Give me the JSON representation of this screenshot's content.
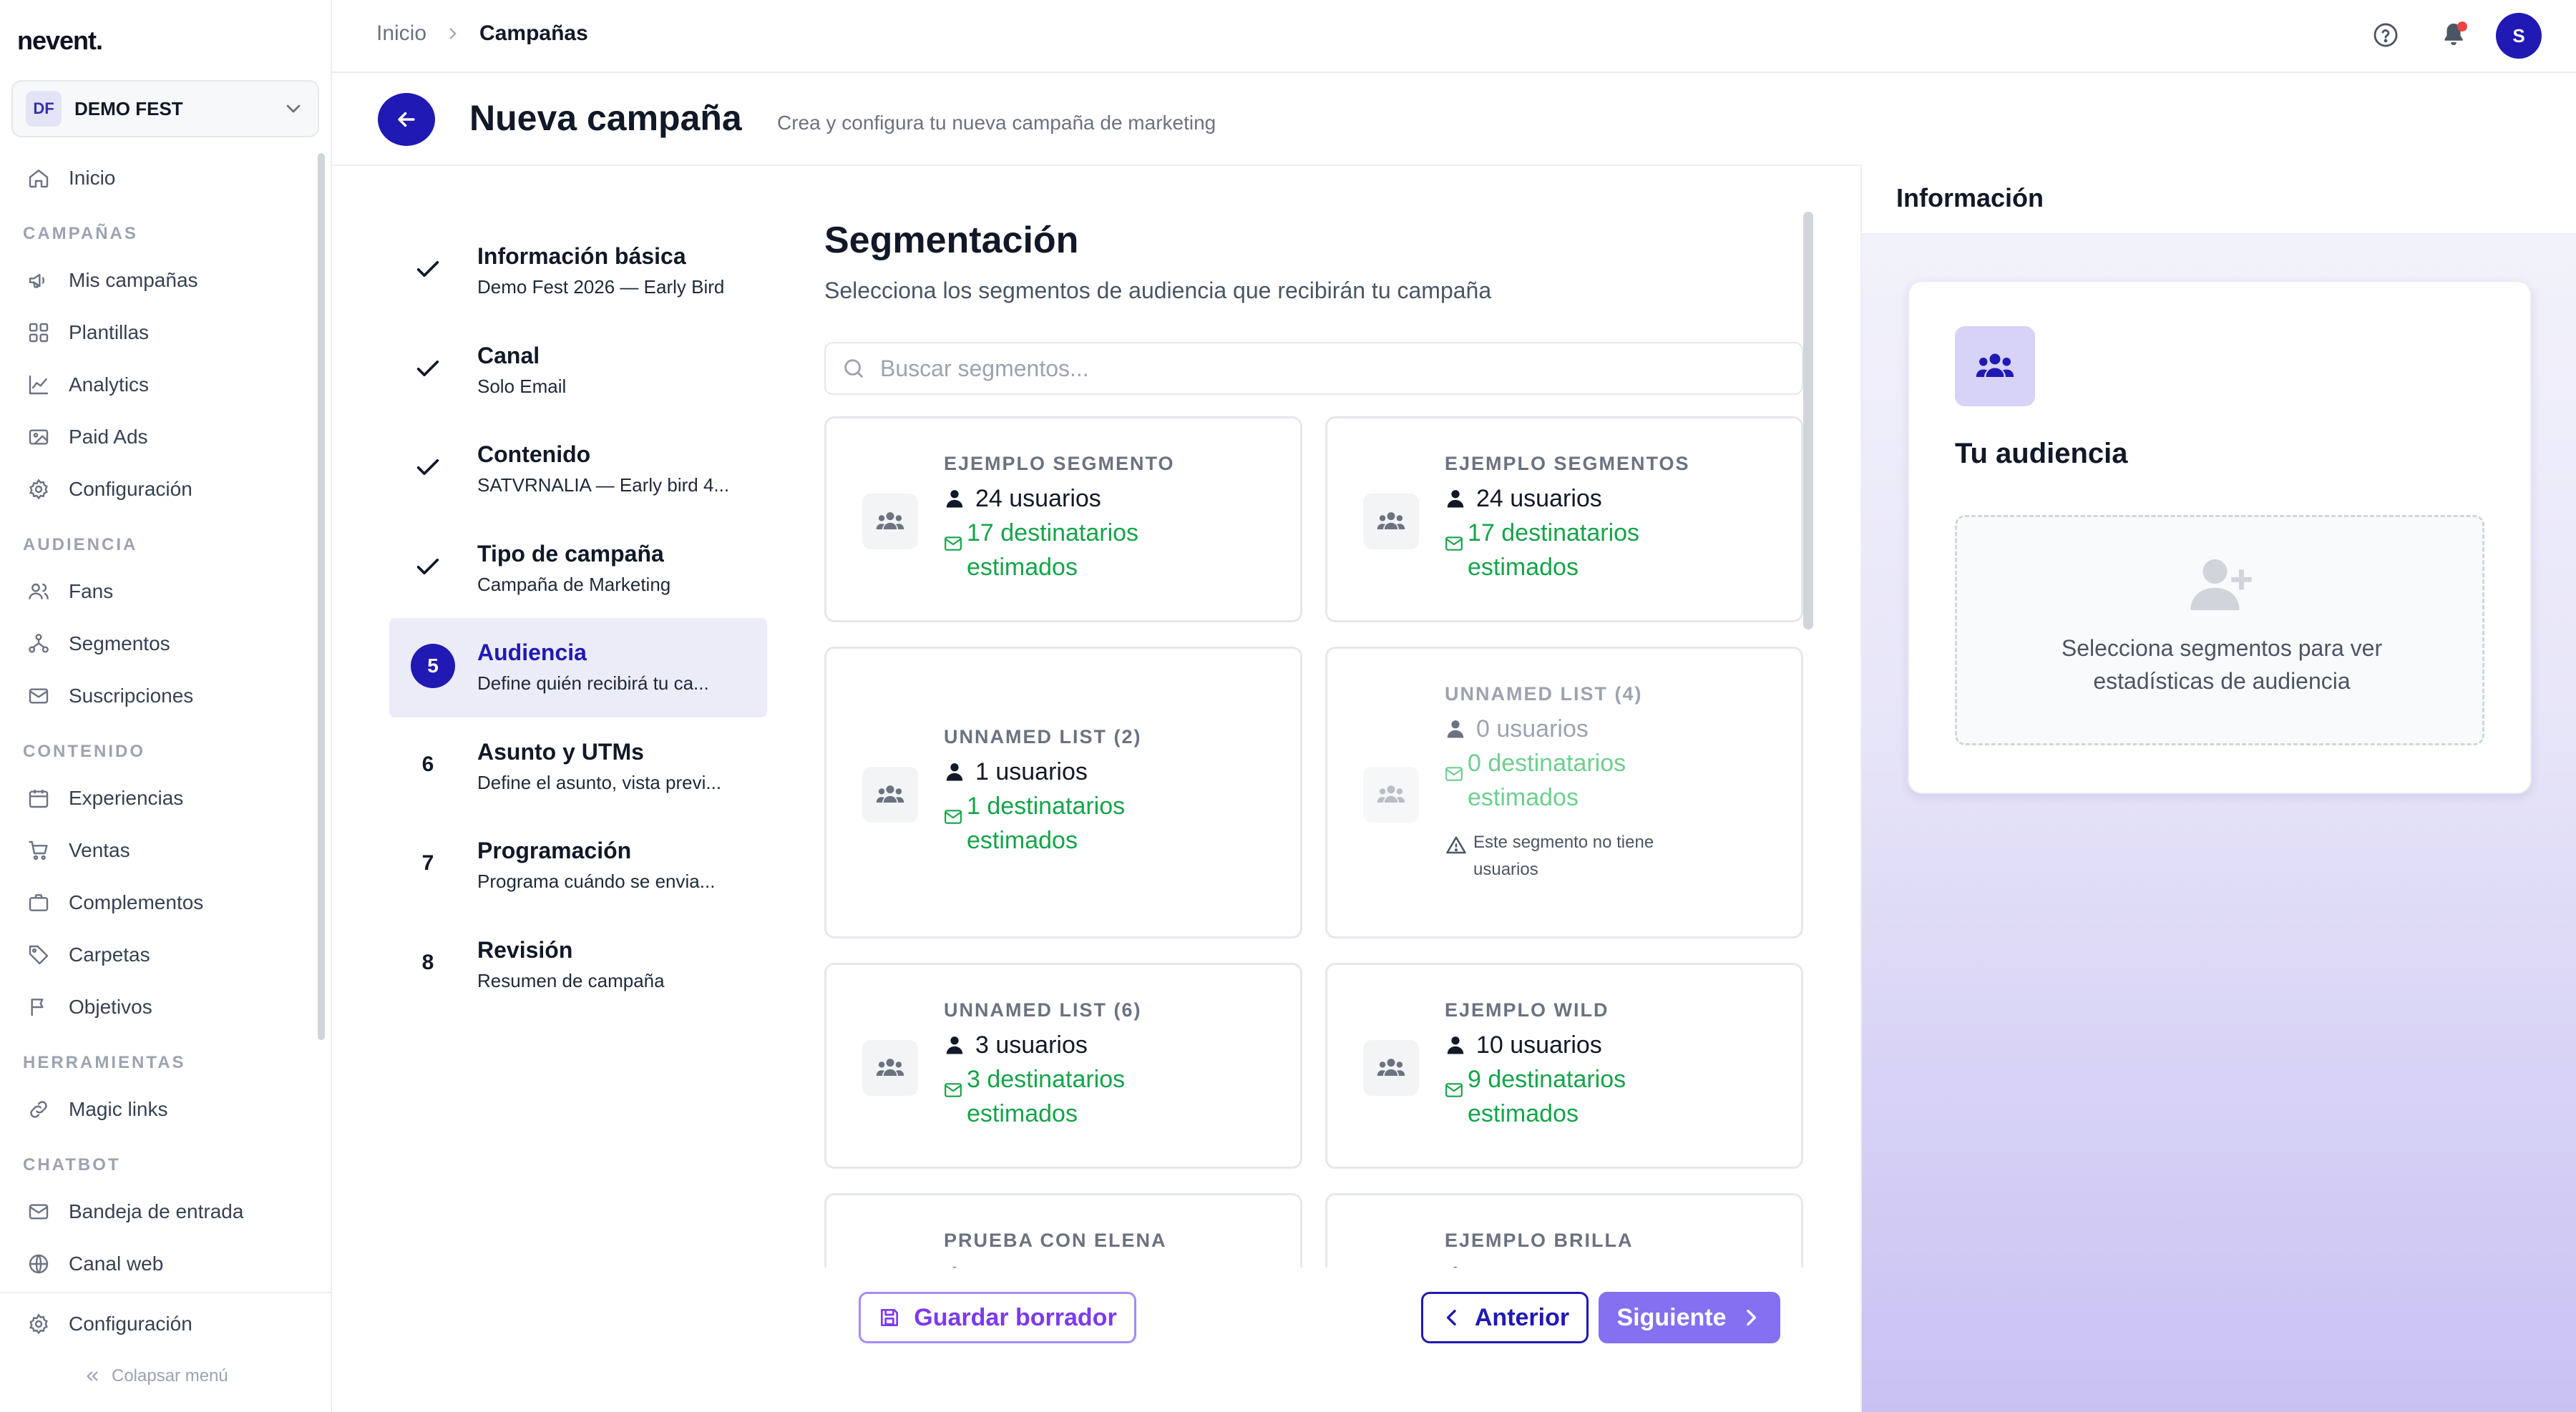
{
  "app": {
    "logo": "nevent."
  },
  "org": {
    "initials": "DF",
    "name": "DEMO FEST"
  },
  "sidebar": {
    "inicio": "Inicio",
    "sec_campanas": "CAMPAÑAS",
    "mis_campanas": "Mis campañas",
    "plantillas": "Plantillas",
    "analytics": "Analytics",
    "paid_ads": "Paid Ads",
    "configuracion": "Configuración",
    "sec_audiencia": "AUDIENCIA",
    "fans": "Fans",
    "segmentos": "Segmentos",
    "suscripciones": "Suscripciones",
    "sec_contenido": "CONTENIDO",
    "experiencias": "Experiencias",
    "ventas": "Ventas",
    "complementos": "Complementos",
    "carpetas": "Carpetas",
    "objetivos": "Objetivos",
    "sec_herramientas": "HERRAMIENTAS",
    "magic_links": "Magic links",
    "sec_chatbot": "CHATBOT",
    "bandeja": "Bandeja de entrada",
    "canal_web": "Canal web",
    "bottom_config": "Configuración",
    "collapse": "Colapsar menú"
  },
  "topbar": {
    "crumb_home": "Inicio",
    "crumb_current": "Campañas",
    "avatar_initial": "S"
  },
  "header": {
    "title": "Nueva campaña",
    "subtitle": "Crea y configura tu nueva campaña de marketing"
  },
  "steps": [
    {
      "mark": "",
      "title": "Información básica",
      "subtitle": "Demo Fest 2026 — Early Bird"
    },
    {
      "mark": "",
      "title": "Canal",
      "subtitle": "Solo Email"
    },
    {
      "mark": "",
      "title": "Contenido",
      "subtitle": "SATVRNALIA — Early bird 4..."
    },
    {
      "mark": "",
      "title": "Tipo de campaña",
      "subtitle": "Campaña de Marketing"
    },
    {
      "mark": "5",
      "title": "Audiencia",
      "subtitle": "Define quién recibirá tu ca..."
    },
    {
      "mark": "6",
      "title": "Asunto y UTMs",
      "subtitle": "Define el asunto, vista previ..."
    },
    {
      "mark": "7",
      "title": "Programación",
      "subtitle": "Programa cuándo se envia..."
    },
    {
      "mark": "8",
      "title": "Revisión",
      "subtitle": "Resumen de campaña"
    }
  ],
  "segmentation": {
    "title": "Segmentación",
    "subtitle": "Selecciona los segmentos de audiencia que recibirán tu campaña",
    "search_placeholder": "Buscar segmentos...",
    "segments": [
      {
        "name": "EJEMPLO SEGMENTO",
        "users": "24 usuarios",
        "dest1": "17 destinatarios",
        "dest2": "estimados"
      },
      {
        "name": "EJEMPLO SEGMENTOS",
        "users": "24 usuarios",
        "dest1": "17 destinatarios",
        "dest2": "estimados"
      },
      {
        "name": "UNNAMED LIST (2)",
        "users": "1 usuarios",
        "dest1": "1 destinatarios",
        "dest2": "estimados"
      },
      {
        "name": "UNNAMED LIST (4)",
        "users": "0 usuarios",
        "dest1": "0 destinatarios",
        "dest2": "estimados",
        "warning": "Este segmento no tiene usuarios"
      },
      {
        "name": "UNNAMED LIST (6)",
        "users": "3 usuarios",
        "dest1": "3 destinatarios",
        "dest2": "estimados"
      },
      {
        "name": "EJEMPLO WILD",
        "users": "10 usuarios",
        "dest1": "9 destinatarios",
        "dest2": "estimados"
      },
      {
        "name": "PRUEBA CON ELENA",
        "users": "",
        "dest1": "",
        "dest2": ""
      },
      {
        "name": "EJEMPLO BRILLA",
        "users": "",
        "dest1": "",
        "dest2": ""
      }
    ]
  },
  "footer": {
    "draft": "Guardar borrador",
    "prev": "Anterior",
    "next": "Siguiente"
  },
  "info_panel": {
    "title": "Información",
    "audience_title": "Tu audiencia",
    "empty_message": "Selecciona segmentos para ver estadísticas de audiencia"
  },
  "colors": {
    "primary": "#2019b3",
    "accent": "#8470f0",
    "success": "#16a34a",
    "draft": "#7c3aed"
  }
}
